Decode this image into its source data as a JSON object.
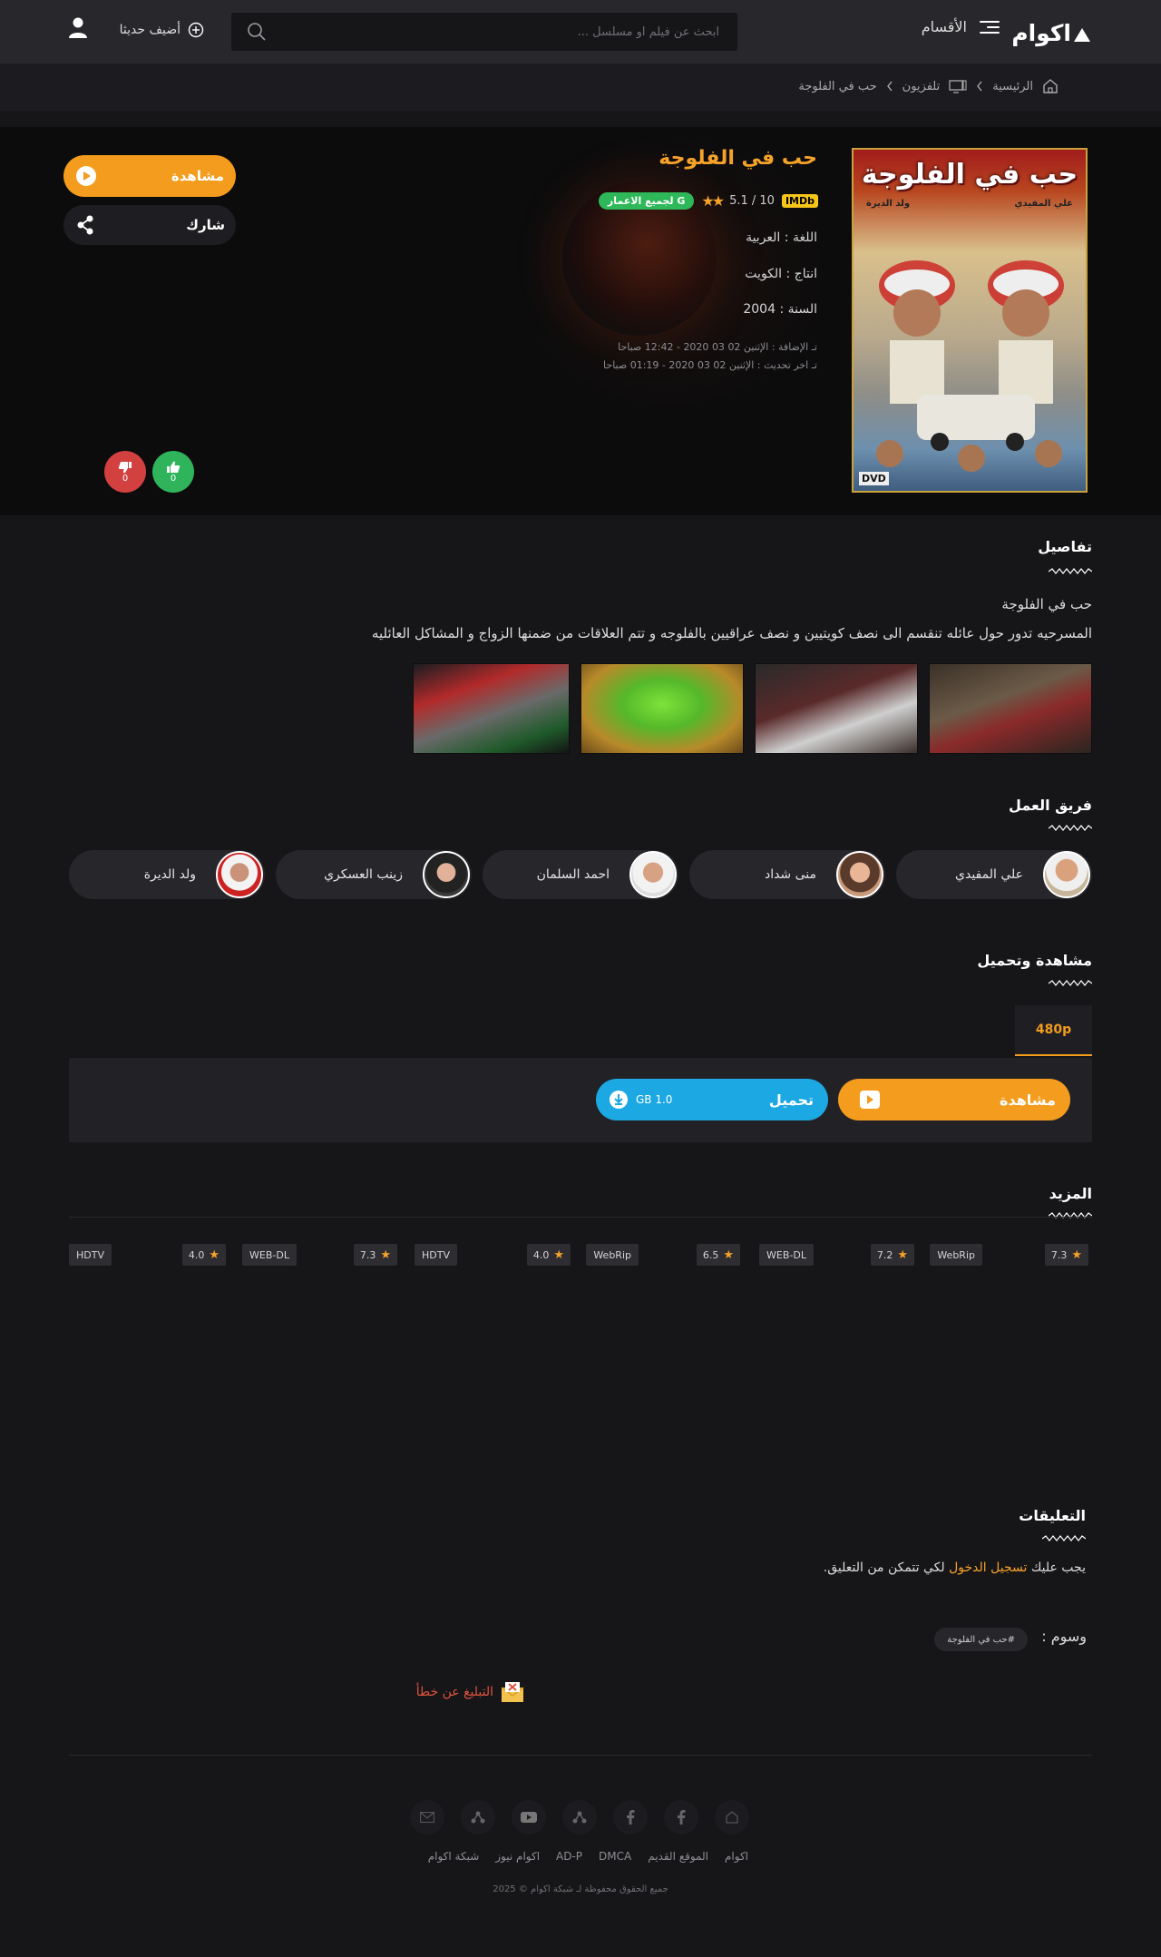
{
  "header": {
    "logo": "اكوام",
    "menu_label": "الأقسام",
    "search_placeholder": "ابحث عن فيلم او مسلسل ...",
    "add_new_label": "أضيف حديثا"
  },
  "breadcrumb": {
    "home": "الرئيسية",
    "section": "تلفزيون",
    "current": "حب في الفلوجة"
  },
  "movie": {
    "title": "حب في الفلوجة",
    "poster_title": "حب في الفلوجة",
    "poster_credit_1": "علي المفيدي",
    "poster_credit_2": "ولد الديرة",
    "poster_badge": "DVD",
    "imdb_label": "IMDb",
    "rating": "10 / 5.1",
    "age_rating": "G لجميع الاعمار",
    "language": "اللغة : العربية",
    "production": "انتاج : الكويت",
    "year": "السنة : 2004",
    "added": "تـ الإضافة : الإثنين 02 03 2020 - 12:42 صباحا",
    "updated": "تـ اخر تحديث : الإثنين 02 03 2020 - 01:19 صباحا",
    "watch_label": "مشاهدة",
    "share_label": "شارك",
    "likes": "0",
    "dislikes": "0"
  },
  "details": {
    "title": "تفاصيل",
    "name": "حب في الفلوجة",
    "description": "المسرحيه تدور حول عائله تنقسم الى نصف كويتيين و نصف عراقيين بالفلوجه و تتم العلاقات من ضمنها الزواج و المشاكل العائليه"
  },
  "cast": {
    "title": "فريق العمل",
    "members": [
      "علي المفيدي",
      "منى شداد",
      "احمد السلمان",
      "زينب العسكري",
      "ولد الديرة"
    ]
  },
  "downloads": {
    "title": "مشاهدة وتحميل",
    "quality_tab": "480p",
    "watch_label": "مشاهدة",
    "download_label": "تحميل",
    "size": "1.0 GB"
  },
  "more": {
    "title": "المزيد",
    "items": [
      {
        "rating": "7.3",
        "quality": "WebRip"
      },
      {
        "rating": "7.2",
        "quality": "WEB-DL"
      },
      {
        "rating": "6.5",
        "quality": "WebRip"
      },
      {
        "rating": "4.0",
        "quality": "HDTV"
      },
      {
        "rating": "7.3",
        "quality": "WEB-DL"
      },
      {
        "rating": "4.0",
        "quality": "HDTV"
      }
    ]
  },
  "comments": {
    "title": "التعليقات",
    "prefix": "يجب عليك",
    "login_link": "تسجيل الدخول",
    "suffix": "لكي تتمكن من التعليق."
  },
  "tags": {
    "label": "وسوم :",
    "chip": "#حب في الفلوجة"
  },
  "report_label": "التبليغ عن خطأ",
  "footer": {
    "links": [
      "اكوام",
      "الموقع القديم",
      "DMCA",
      "AD-P",
      "اكوام نيوز",
      "شبكة اكوام"
    ],
    "copyright": "جميع الحقوق محفوظة لـ شبكة اكوام © 2025"
  },
  "colors": {
    "accent": "#f39c1d",
    "download": "#1ca8e3",
    "like": "#2fb45c",
    "dislike": "#d34040",
    "age_badge": "#2fb85a"
  }
}
